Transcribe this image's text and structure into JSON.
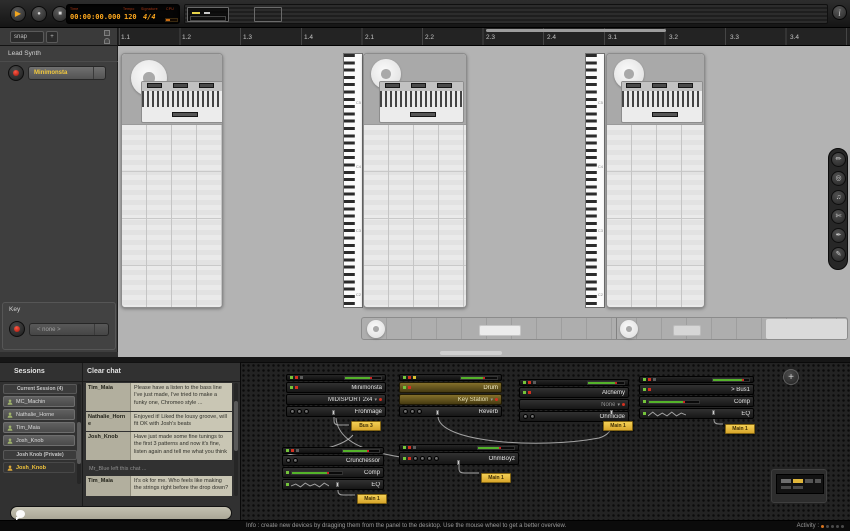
{
  "transport": {
    "play": "▶",
    "record": "●",
    "stop": "■",
    "info": "i",
    "lcd": {
      "time_label": "Time",
      "time": "00:00:00.000",
      "tempo_label": "Tempo",
      "tempo": "120",
      "sig_label": "Signature",
      "sig": "4/4",
      "cpu_label": "CPU"
    }
  },
  "snap": {
    "label": "snap",
    "add": "+"
  },
  "ruler": {
    "labels": [
      "1.1",
      "1.2",
      "1.3",
      "1.4",
      "2.1",
      "2.2",
      "2.3",
      "2.4",
      "3.1",
      "3.2",
      "3.3",
      "3.4"
    ]
  },
  "left_panel": {
    "track_name": "Lead Synth",
    "clip_label": "Minimonsta",
    "key_label": "Key",
    "key_value": "< none >"
  },
  "keyboard": {
    "octaves": [
      "C5",
      "C4",
      "C3",
      "C2"
    ]
  },
  "palette": {
    "tools": [
      {
        "name": "draw",
        "glyph": "✏"
      },
      {
        "name": "select",
        "glyph": "◎"
      },
      {
        "name": "note",
        "glyph": "♫"
      },
      {
        "name": "cut",
        "glyph": "✄"
      },
      {
        "name": "pen",
        "glyph": "✒"
      },
      {
        "name": "erase",
        "glyph": "✎"
      }
    ]
  },
  "sessions": {
    "title": "Sessions",
    "current": "Current Session (4)",
    "users": [
      "MC_Machin",
      "Nathalie_Horne",
      "Tim_Maia",
      "Josh_Knob"
    ],
    "private": "Josh Knob (Private)",
    "active_user": "Josh_Knob"
  },
  "chat": {
    "clear": "Clear chat",
    "messages": [
      {
        "name": "Tim_Maia",
        "text": "Please have a listen to the bass line I've just made, I've tried to make a funky one, Chromeo style ..."
      },
      {
        "name": "Nathalie_Horne",
        "text": "Enjoyed it! Liked the lousy groove, will fit OK with Josh's beats"
      },
      {
        "name": "Josh_Knob",
        "text": "Have just made some fine tunings to the first 3 patterns and now it's fine, listen again and tell me what you think"
      }
    ],
    "status": "Mr_Blue left this chat ...",
    "last": {
      "name": "Tim_Maia",
      "text": "It's ok for me. Who feels like making the strings right before the drop down?"
    }
  },
  "rack": {
    "add": "+",
    "stacks": [
      {
        "rows": [
          {
            "label": "Minimonsta"
          },
          {
            "label": "MIDISPORT 2x4"
          },
          {
            "label": "Frohmage"
          }
        ]
      },
      {
        "rows": [
          {
            "label": "Drum"
          },
          {
            "label": "Key Station"
          },
          {
            "label": "Reverb"
          }
        ]
      },
      {
        "rows": [
          {
            "label": "Alchemy"
          },
          {
            "label": "None"
          },
          {
            "label": "Ohmicide"
          }
        ]
      },
      {
        "rows": [
          {
            "label": "> Bus1"
          },
          {
            "label": "Comp"
          },
          {
            "label": "EQ"
          }
        ]
      },
      {
        "rows": [
          {
            "label": "Crunchessor"
          },
          {
            "label": "Comp"
          },
          {
            "label": "EQ"
          }
        ]
      },
      {
        "rows": [
          {
            "label": "OhmBoyz"
          }
        ]
      }
    ],
    "tags": [
      {
        "label": "Bus 3"
      },
      {
        "label": "Main 1"
      },
      {
        "label": "Main 1"
      },
      {
        "label": "Main 1"
      },
      {
        "label": "Main 1"
      }
    ]
  },
  "status": {
    "info": "Info : create new devices by dragging them from the panel to the desktop. Use the mouse wheel to get a better overview.",
    "activity": "Activity :"
  }
}
